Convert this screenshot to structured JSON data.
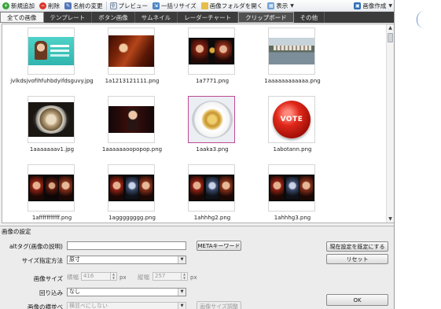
{
  "toolbar": {
    "new": "新規追加",
    "delete": "削除",
    "rename": "名前の変更",
    "preview": "プレビュー",
    "batch_resize": "一括リサイズ",
    "open_folder": "画像フォルダを開く",
    "view": "表示",
    "create": "画像作成"
  },
  "tabs": [
    {
      "label": "全ての画像"
    },
    {
      "label": "テンプレート"
    },
    {
      "label": "ボタン画像"
    },
    {
      "label": "サムネイル"
    },
    {
      "label": "レーダーチャート"
    },
    {
      "label": "クリップボード"
    },
    {
      "label": "その他"
    }
  ],
  "images": [
    {
      "name": "jvlkdsjvofihfuhbdyifdsguvy.jpg"
    },
    {
      "name": "1a1213121111.png"
    },
    {
      "name": "1a7771.png"
    },
    {
      "name": "1aaaaaaaaaaaa.png"
    },
    {
      "name": "1aaaaaaav1.jpg"
    },
    {
      "name": "1aaaaaaoopopop.png"
    },
    {
      "name": "1aaka3.png"
    },
    {
      "name": "1abotann.png"
    },
    {
      "name": "1afffffffffff.png"
    },
    {
      "name": "1agggggggg.png"
    },
    {
      "name": "1ahhhg2.png"
    },
    {
      "name": "1ahhhg3.png"
    }
  ],
  "vote_text": "VOTE",
  "settings": {
    "title": "画像の設定",
    "alt_label": "altタグ(画像の説明)",
    "alt_value": "",
    "meta_button": "METAキーワード",
    "size_method_label": "サイズ指定方法",
    "size_method_value": "原寸",
    "size_label": "画像サイズ",
    "width_label": "横幅",
    "width_value": "416",
    "height_label": "縦幅",
    "height_value": "257",
    "unit": "px",
    "wrap_label": "回り込み",
    "wrap_value": "なし",
    "align_label": "画像の横並べ",
    "align_value": "横並べにしない",
    "resize_button": "画像サイズ調整",
    "save_default_button": "現在設定を既定にする",
    "reset_button": "リセット",
    "ok_button": "OK"
  }
}
